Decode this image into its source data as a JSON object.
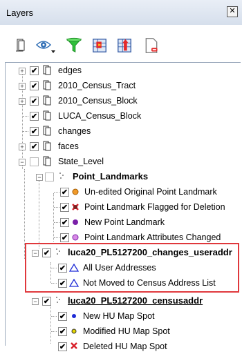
{
  "panel": {
    "title": "Layers"
  },
  "toolbar": {
    "buttons": [
      "layer-add",
      "visibility-eye",
      "filter-funnel",
      "open-table",
      "table-sort",
      "remove-layer"
    ]
  },
  "tree": {
    "edges": "edges",
    "census_tract": "2010_Census_Tract",
    "census_block": "2010_Census_Block",
    "luca_census_block": "LUCA_Census_Block",
    "changes": "changes",
    "faces": "faces",
    "state_level": "State_Level",
    "point_landmarks": "Point_Landmarks",
    "pl_unedited": "Un-edited Original Point Landmark",
    "pl_flagged": "Point Landmark Flagged for Deletion",
    "pl_new": "New Point Landmark",
    "pl_attr_changed": "Point Landmark Attributes Changed",
    "changes_useraddr": "luca20_PL5127200_changes_useraddr",
    "all_user_addresses": "All User Addresses",
    "not_moved": "Not Moved to Census Address List",
    "censusaddr": "luca20_PL5127200_censusaddr",
    "new_hu": "New HU Map Spot",
    "modified_hu": "Modified HU Map Spot",
    "deleted_hu": "Deleted HU Map Spot"
  },
  "colors": {
    "highlight_border": "#e0383c",
    "orange_symbol": "#f09a2a",
    "purple_symbol": "#7a1fa8",
    "blue_symbol": "#1e2bd6",
    "yellow_symbol": "#e6d800",
    "red_symbol": "#d8202a"
  }
}
